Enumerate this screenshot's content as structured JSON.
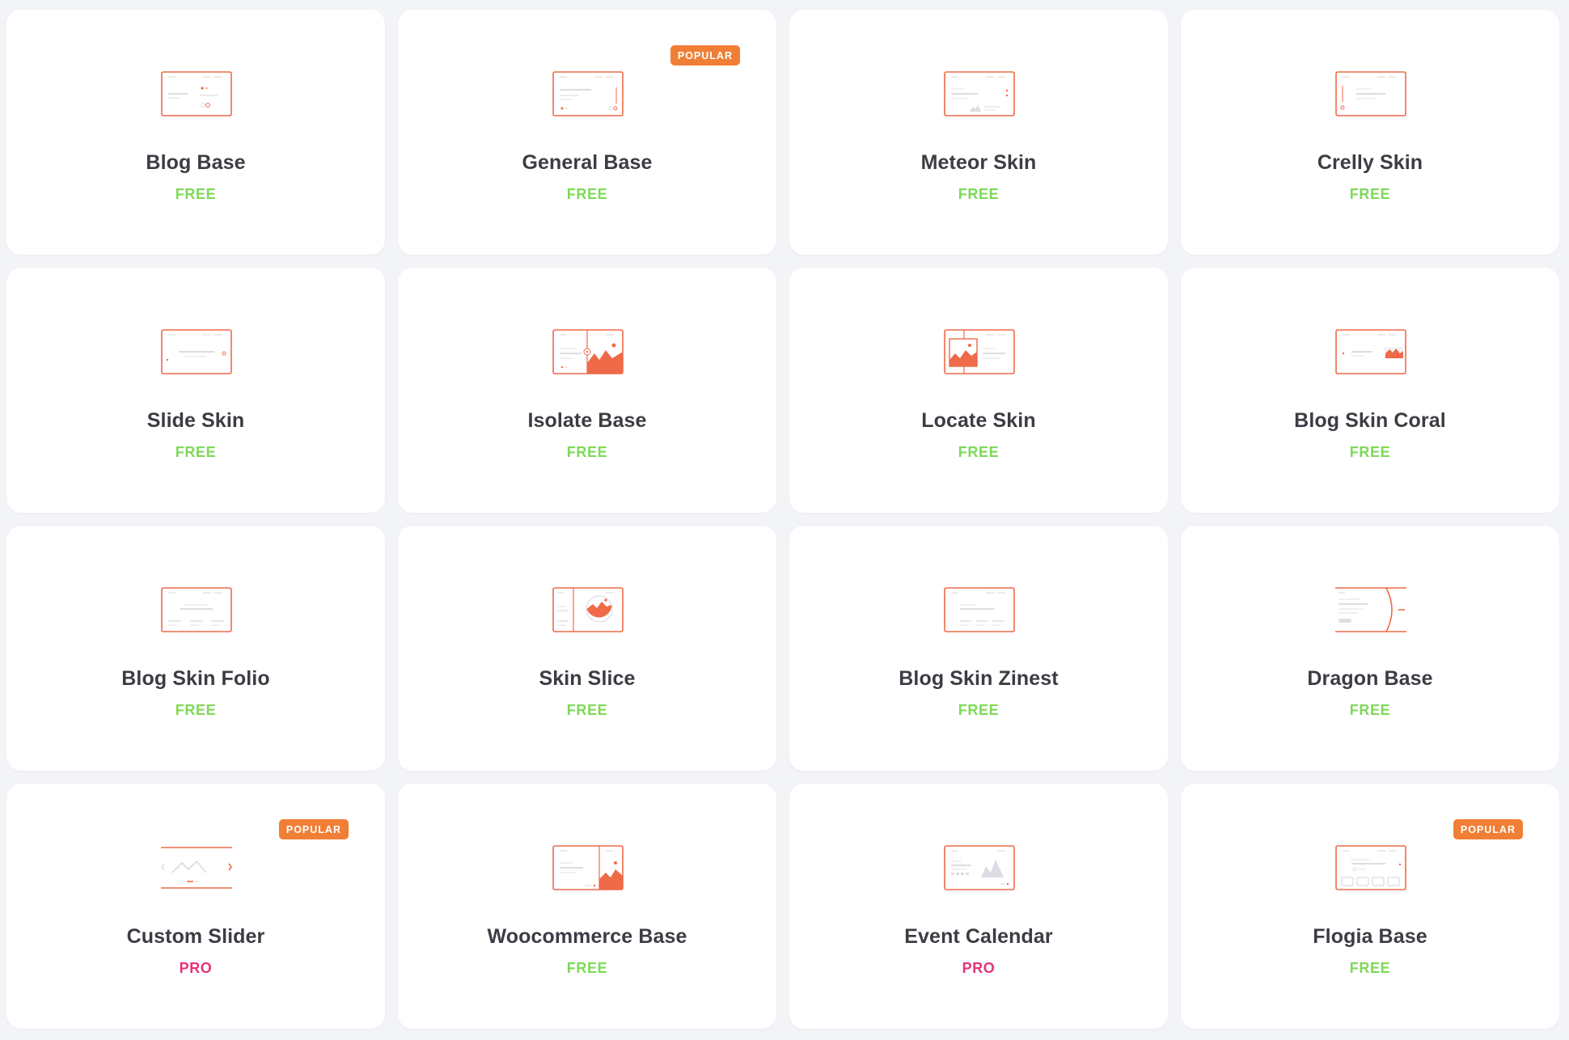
{
  "colors": {
    "accent": "#ee6a48",
    "free": "#7ed957",
    "pro": "#e5327a",
    "badge": "#f07f35"
  },
  "cards": [
    {
      "title": "Blog Base",
      "tier": "FREE",
      "badge": "",
      "thumb": "blog-base"
    },
    {
      "title": "General Base",
      "tier": "FREE",
      "badge": "POPULAR",
      "thumb": "general-base"
    },
    {
      "title": "Meteor Skin",
      "tier": "FREE",
      "badge": "",
      "thumb": "meteor-skin"
    },
    {
      "title": "Crelly Skin",
      "tier": "FREE",
      "badge": "",
      "thumb": "crelly-skin"
    },
    {
      "title": "Slide Skin",
      "tier": "FREE",
      "badge": "",
      "thumb": "slide-skin"
    },
    {
      "title": "Isolate Base",
      "tier": "FREE",
      "badge": "",
      "thumb": "isolate-base"
    },
    {
      "title": "Locate Skin",
      "tier": "FREE",
      "badge": "",
      "thumb": "locate-skin"
    },
    {
      "title": "Blog Skin Coral",
      "tier": "FREE",
      "badge": "",
      "thumb": "blog-skin-coral"
    },
    {
      "title": "Blog Skin Folio",
      "tier": "FREE",
      "badge": "",
      "thumb": "blog-skin-folio"
    },
    {
      "title": "Skin Slice",
      "tier": "FREE",
      "badge": "",
      "thumb": "skin-slice"
    },
    {
      "title": "Blog Skin Zinest",
      "tier": "FREE",
      "badge": "",
      "thumb": "blog-skin-zinest"
    },
    {
      "title": "Dragon Base",
      "tier": "FREE",
      "badge": "",
      "thumb": "dragon-base"
    },
    {
      "title": "Custom Slider",
      "tier": "PRO",
      "badge": "POPULAR",
      "thumb": "custom-slider"
    },
    {
      "title": "Woocommerce Base",
      "tier": "FREE",
      "badge": "",
      "thumb": "woocommerce-base"
    },
    {
      "title": "Event Calendar",
      "tier": "PRO",
      "badge": "",
      "thumb": "event-calendar"
    },
    {
      "title": "Flogia Base",
      "tier": "FREE",
      "badge": "POPULAR",
      "thumb": "flogia-base"
    }
  ]
}
